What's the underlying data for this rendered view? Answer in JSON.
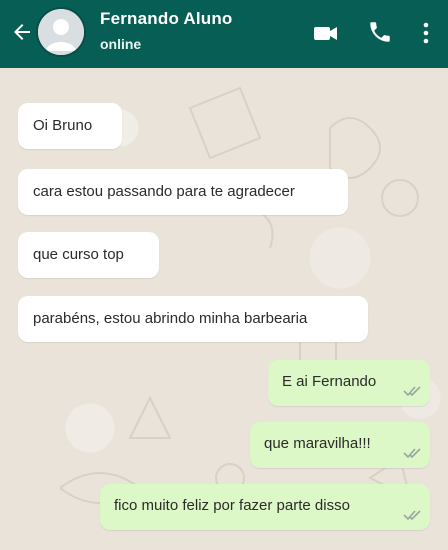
{
  "header": {
    "contact_name": "Fernando Aluno",
    "status": "online",
    "icons": [
      "back-arrow-icon",
      "avatar",
      "video-call-icon",
      "phone-icon",
      "more-vert-icon"
    ]
  },
  "messages": {
    "incoming": [
      {
        "text": "Oi Bruno"
      },
      {
        "text": "cara estou passando para te agradecer"
      },
      {
        "text": "que curso top"
      },
      {
        "text": "parabéns, estou abrindo minha barbearia"
      }
    ],
    "outgoing": [
      {
        "text": "E ai Fernando",
        "status": "read-double-check"
      },
      {
        "text": "que maravilha!!!",
        "status": "read-double-check"
      },
      {
        "text": "fico muito feliz por fazer parte disso",
        "status": "read-double-check"
      }
    ]
  },
  "colors": {
    "header_bg": "#075e54",
    "incoming_bubble": "#ffffff",
    "outgoing_bubble": "#dcf8c6",
    "chat_bg": "#e9e3da"
  }
}
